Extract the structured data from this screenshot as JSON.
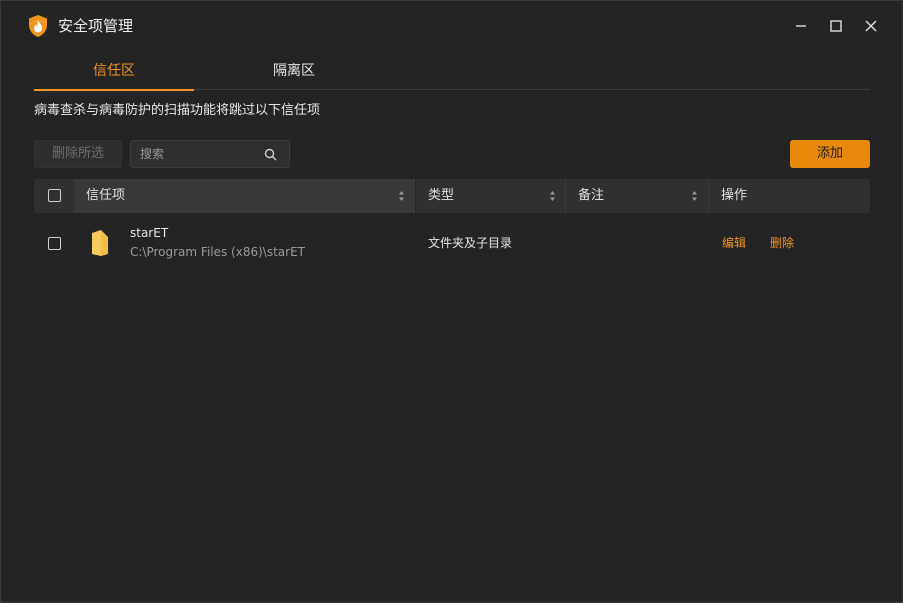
{
  "window": {
    "title": "安全项管理",
    "accent_color": "#f0951e",
    "icon": "shield-flame-icon"
  },
  "tabs": [
    {
      "label": "信任区",
      "active": true
    },
    {
      "label": "隔离区",
      "active": false
    }
  ],
  "description": "病毒查杀与病毒防护的扫描功能将跳过以下信任项",
  "toolbar": {
    "delete_selected_label": "删除所选",
    "search_placeholder": "搜索",
    "add_label": "添加"
  },
  "table": {
    "columns": [
      "信任项",
      "类型",
      "备注",
      "操作"
    ],
    "rows": [
      {
        "icon": "folder-icon",
        "name": "starET",
        "path": "C:\\Program Files (x86)\\starET",
        "type": "文件夹及子目录",
        "note": "",
        "actions": [
          "编辑",
          "删除"
        ]
      }
    ]
  }
}
